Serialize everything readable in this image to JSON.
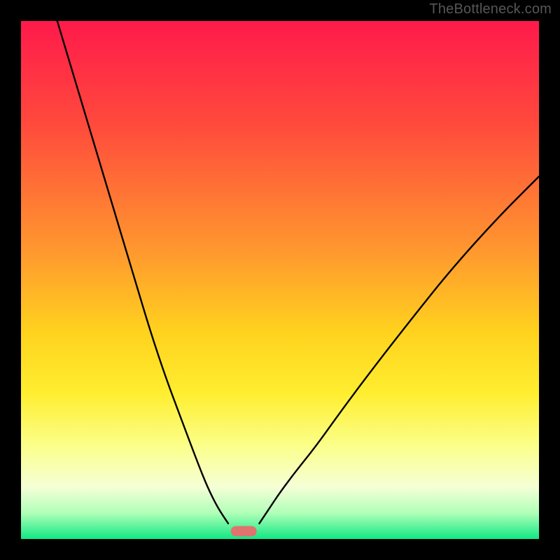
{
  "watermark": "TheBottleneck.com",
  "chart_data": {
    "type": "line",
    "title": "",
    "xlabel": "",
    "ylabel": "",
    "xlim": [
      0,
      100
    ],
    "ylim": [
      0,
      100
    ],
    "grid": false,
    "legend": false,
    "gradient_stops": [
      {
        "pct": 0,
        "hex": "#ff1a4b"
      },
      {
        "pct": 20,
        "hex": "#ff4a3c"
      },
      {
        "pct": 45,
        "hex": "#ff9a2e"
      },
      {
        "pct": 60,
        "hex": "#ffd21e"
      },
      {
        "pct": 72,
        "hex": "#ffee30"
      },
      {
        "pct": 82,
        "hex": "#fbff8a"
      },
      {
        "pct": 90,
        "hex": "#f5ffd6"
      },
      {
        "pct": 95,
        "hex": "#b0ffb8"
      },
      {
        "pct": 100,
        "hex": "#10e884"
      }
    ],
    "series": [
      {
        "name": "curve-left",
        "color": "#000000",
        "x": [
          7,
          10,
          13,
          16,
          19,
          22,
          25,
          28,
          31,
          34,
          36,
          38,
          40
        ],
        "y": [
          100,
          90,
          80,
          70,
          60,
          50,
          40,
          31,
          23,
          15,
          10,
          6,
          3
        ]
      },
      {
        "name": "curve-right",
        "color": "#000000",
        "x": [
          46,
          48,
          50,
          53,
          57,
          62,
          68,
          75,
          83,
          92,
          100
        ],
        "y": [
          3,
          6,
          9,
          13,
          18,
          25,
          33,
          42,
          52,
          62,
          70
        ]
      }
    ],
    "marker": {
      "x": 43,
      "y": 1.5,
      "width_pct": 5,
      "height_pct": 2,
      "rx_pct": 1,
      "color": "#e0736e"
    }
  }
}
